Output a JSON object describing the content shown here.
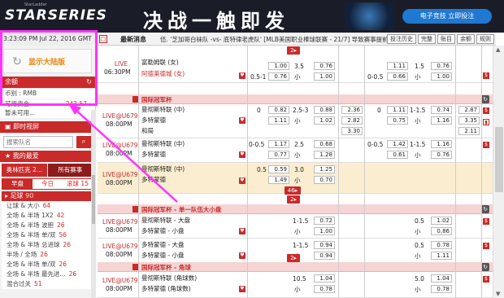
{
  "banner": {
    "logo": "STARSERIES",
    "logo_sub": "StarLadder",
    "slogan": "决战一触即发",
    "promo_button": "电子竞技 立即投注"
  },
  "left": {
    "datetime": "3:23:09 PM Jul 22, 2016 GMT +8",
    "mainland_label": "显示大陆版",
    "balance_title": "余额",
    "currency_row": "币别 : RMB",
    "credit_label": "可用资金",
    "credit_value": "243.57",
    "pending_label": "暂未可用...",
    "live_title": "即时视屏",
    "search_placeholder": "搜索队名",
    "fav_title": "我的最爱",
    "tab_a": "奥林匹克 2...",
    "tab_b": "所有赛事",
    "tab_early": "早盘",
    "tab_today": "今日",
    "tab_live": "滚球",
    "tab_live_count": "15",
    "sport_name": "足球",
    "sport_count": "90",
    "markets": [
      {
        "label": "让球 & 大小",
        "count": "64"
      },
      {
        "label": "全场 & 半场 1X2",
        "count": "42"
      },
      {
        "label": "全场 & 半场 波胆",
        "count": "26"
      },
      {
        "label": "全场 & 半场 单/双",
        "count": "56"
      },
      {
        "label": "全场 & 半场 总进球",
        "count": "26"
      },
      {
        "label": "半场 / 全场",
        "count": "26"
      },
      {
        "label": "全场 & 半场 单/双",
        "count": "26"
      },
      {
        "label": "全场 & 半场 最先进...",
        "count": "26"
      },
      {
        "label": "混合过关",
        "count": "51"
      }
    ]
  },
  "header": {
    "sq": "□",
    "news": "最新消息",
    "ticker": "伍. '芝加哥白袜队 -vs- 底特律老虎队' [MLB美国职业棒球联赛 - 21/7] 导致赛事提前开",
    "btn_history": "投注历史",
    "btn_complete": "完整",
    "btn_bets": "账目",
    "btn_balance": "余额",
    "btn_rules": "规则"
  },
  "rows": [
    {
      "time_a": "LIVE",
      "time_b": "06:30PM",
      "home": "富勒姆联 (女)",
      "away": "阿德莱德城 (女)",
      "hcap": "0.5-1",
      "h1": "1.00",
      "h2": "0.76",
      "ou": "3.5",
      "ou_under": "小",
      "o1": "0.76",
      "o2": "1.00",
      "hhcap": "0-0.5",
      "hh1": "1.11",
      "hh2": "0.66",
      "hou": "1.5",
      "hou_under": "小",
      "ho1": "0.76",
      "ho2": "1.00"
    },
    {
      "time_a": "LIVE@U679",
      "time_b": "08:00PM",
      "home": "曼彻斯特联 (中)",
      "away": "多特蒙德",
      "draw": "和局",
      "hcap": "0",
      "h1": "0.82",
      "h2": "1.11",
      "ou": "2.5-3",
      "ou_under": "小",
      "o1": "0.88",
      "o2": "1.02",
      "x1": "2.36",
      "x2": "2.82",
      "x3": "3.30",
      "hhcap": "0",
      "hh1": "1.11",
      "hh2": "0.75",
      "hou": "1-1.5",
      "hou_under": "小",
      "ho1": "0.74",
      "ho2": "1.16",
      "hx1": "2.87",
      "hx2": "3.35",
      "hx3": "2.11"
    },
    {
      "time_a": "LIVE@U679",
      "time_b": "08:00PM",
      "home": "曼彻斯特联 (中)",
      "away": "多特蒙德",
      "hcap": "0-0.5",
      "h1": "1.17",
      "h2": "0.77",
      "ou": "2.5",
      "ou_under": "小",
      "o1": "0.68",
      "o2": "1.28",
      "hhcap": "0-0.5",
      "hh1": "1.42",
      "hh2": "0.61",
      "hou": "1-1.5",
      "hou_under": "小",
      "ho1": "1.16",
      "ho2": "0.76"
    },
    {
      "time_a": "LIVE@U679",
      "time_b": "08:00PM",
      "home": "曼彻斯特联 (中)",
      "away": "多特蒙德",
      "hcap": "0.5",
      "h1": "0.59",
      "h2": "1.49",
      "ou": "3.0",
      "ou_under": "小",
      "o1": "1.25",
      "o2": "0.70",
      "more": "46"
    },
    {
      "time_a": "LIVE@U679",
      "time_b": "08:00PM",
      "home": "曼彻斯特联 - 大盘",
      "away": "多特蒙德 - 小盘",
      "hcap": "",
      "h1": "",
      "h2": "",
      "ou": "1-1.5",
      "ou_under": "小",
      "o1": "0.72",
      "o2": "1.00",
      "hou": "0.5",
      "hou_under": "小",
      "ho1": "1.02",
      "ho2": "0.86"
    },
    {
      "time_a": "LIVE@U679",
      "time_b": "08:00PM",
      "home": "多特蒙德 - 大盘",
      "away": "多特蒙德 - 小盘",
      "ou": "1-1.5",
      "ou_under": "小",
      "o1": "0.94",
      "o2": "0.94",
      "hou": "0.5",
      "hou_under": "小",
      "ho1": "0.78",
      "ho2": "1.11"
    },
    {
      "time_a": "LIVE@U679",
      "time_b": "08:00PM",
      "home": "曼彻斯特联 (角球数)",
      "away": "多特蒙德 (角球数)",
      "ou": "10.5",
      "ou_under": "小",
      "o1": "1.04",
      "o2": "0.78",
      "hou": "5.0",
      "hou_under": "小",
      "ho1": "1.04",
      "ho2": "0.78"
    }
  ],
  "pills": [
    "2",
    "2",
    "2"
  ],
  "leagues": [
    "国际冠军杯",
    "国际冠军杯 - 单一队伍大小盘",
    "国际冠军杯 - 角球"
  ]
}
